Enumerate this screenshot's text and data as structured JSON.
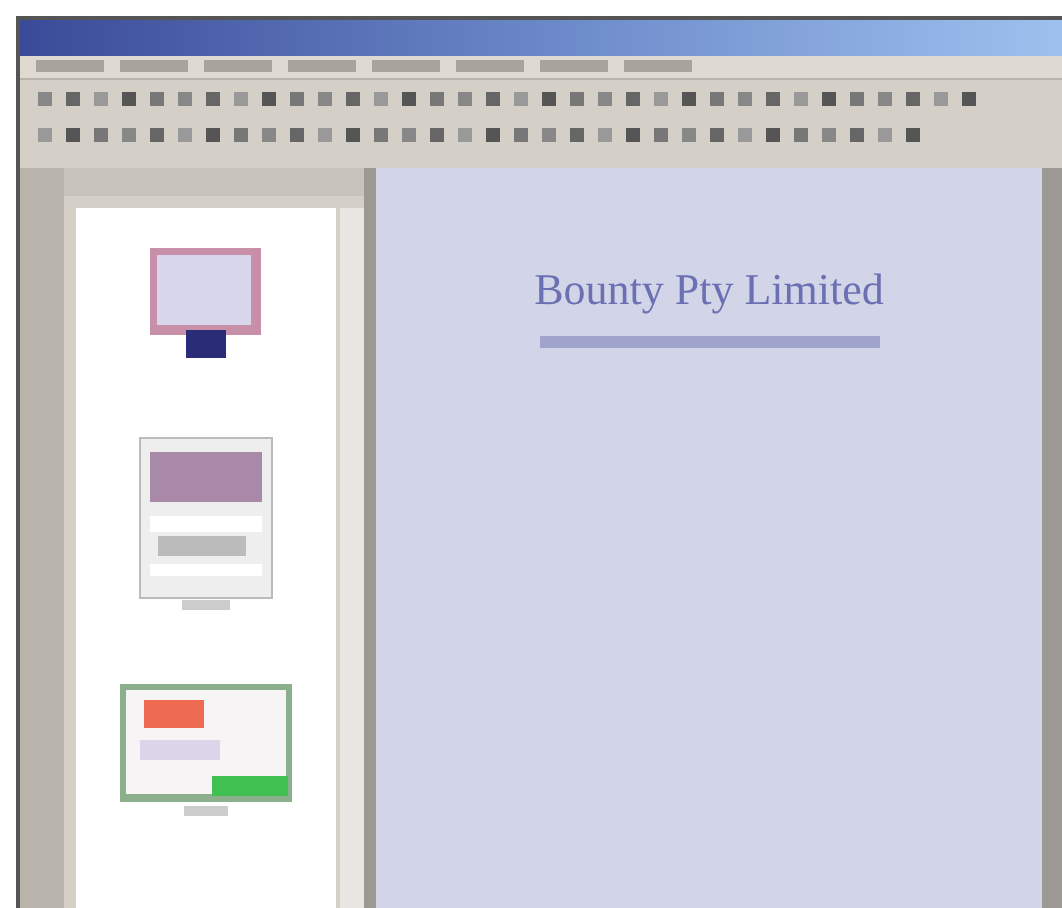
{
  "slide": {
    "title": "Bounty Pty Limited"
  },
  "thumbnails": [
    {
      "kind": "title"
    },
    {
      "kind": "table"
    },
    {
      "kind": "chart"
    }
  ]
}
